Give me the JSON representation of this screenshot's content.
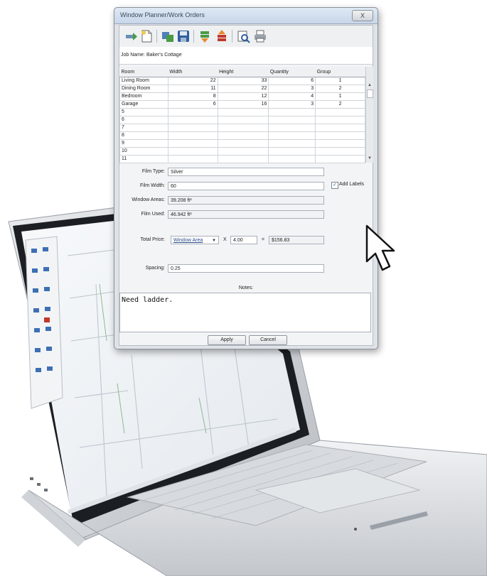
{
  "window": {
    "title": "Window Planner/Work Orders",
    "close_label": "X"
  },
  "toolbar": {
    "icons": [
      "new-record-icon",
      "new-document-icon",
      "open-icon",
      "save-icon",
      "move-down-icon",
      "move-up-icon",
      "print-preview-icon",
      "print-icon"
    ]
  },
  "job": {
    "label": "Job Name:",
    "value": "Baker's Cottage"
  },
  "table": {
    "headers": [
      "Room",
      "Width",
      "Height",
      "Quantity",
      "Group"
    ],
    "rows": [
      [
        "Living Room",
        "22",
        "33",
        "6",
        "1"
      ],
      [
        "Dining Room",
        "11",
        "22",
        "3",
        "2"
      ],
      [
        "Bedroom",
        "8",
        "12",
        "4",
        "1"
      ],
      [
        "Garage",
        "6",
        "16",
        "3",
        "2"
      ],
      [
        "5",
        "",
        "",
        "",
        ""
      ],
      [
        "6",
        "",
        "",
        "",
        ""
      ],
      [
        "7",
        "",
        "",
        "",
        ""
      ],
      [
        "8",
        "",
        "",
        "",
        ""
      ],
      [
        "9",
        "",
        "",
        "",
        ""
      ],
      [
        "10",
        "",
        "",
        "",
        ""
      ],
      [
        "11",
        "",
        "",
        "",
        ""
      ]
    ]
  },
  "form": {
    "film_type_label": "Film Type:",
    "film_type_value": "Silver",
    "film_width_label": "Film Width:",
    "film_width_value": "60",
    "add_labels_label": "Add Labels",
    "add_labels_checked": "✓",
    "window_areas_label": "Window Areas:",
    "window_areas_value": "39.208 ft²",
    "film_used_label": "Film Used:",
    "film_used_value": "46.942 ft²",
    "total_price_label": "Total Price:",
    "total_price_basis": "Window Area",
    "times": "X",
    "rate": "4.00",
    "equals": "=",
    "total": "$156.83",
    "spacing_label": "Spacing:",
    "spacing_value": "0.25"
  },
  "notes": {
    "label": "Notes:",
    "text": "Need ladder."
  },
  "buttons": {
    "apply": "Apply",
    "cancel": "Cancel"
  }
}
